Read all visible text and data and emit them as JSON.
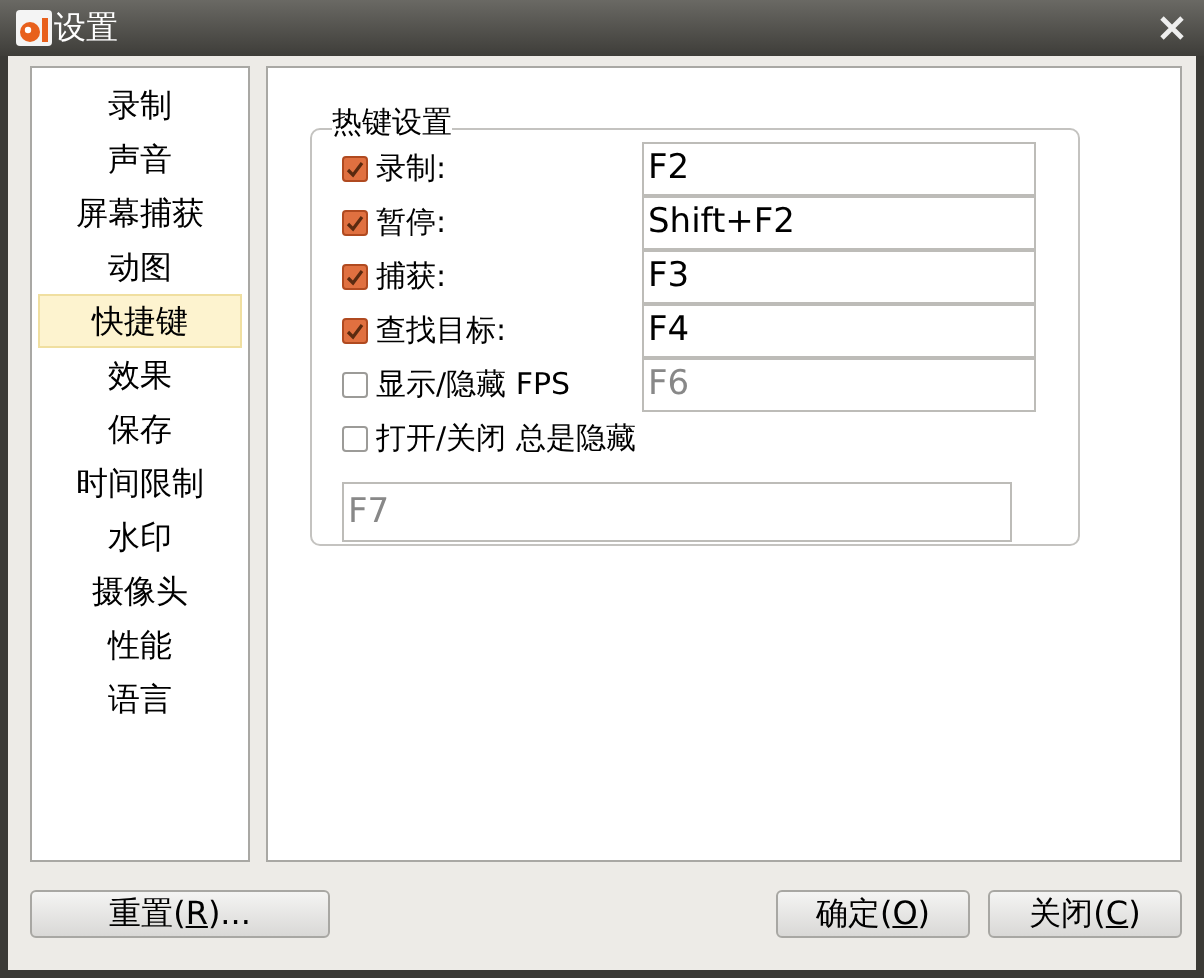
{
  "window": {
    "title": "设置"
  },
  "sidebar": {
    "items": [
      {
        "label": "录制",
        "selected": false
      },
      {
        "label": "声音",
        "selected": false
      },
      {
        "label": "屏幕捕获",
        "selected": false
      },
      {
        "label": "动图",
        "selected": false
      },
      {
        "label": "快捷键",
        "selected": true
      },
      {
        "label": "效果",
        "selected": false
      },
      {
        "label": "保存",
        "selected": false
      },
      {
        "label": "时间限制",
        "selected": false
      },
      {
        "label": "水印",
        "selected": false
      },
      {
        "label": "摄像头",
        "selected": false
      },
      {
        "label": "性能",
        "selected": false
      },
      {
        "label": "语言",
        "selected": false
      }
    ]
  },
  "hotkeys": {
    "title": "热键设置",
    "rows": [
      {
        "label": "录制:",
        "checked": true,
        "field": {
          "value": "F2",
          "disabled": false
        }
      },
      {
        "label": "暂停:",
        "checked": true,
        "field": {
          "value": "Shift+F2",
          "disabled": false
        }
      },
      {
        "label": "捕获:",
        "checked": true,
        "field": {
          "value": "F3",
          "disabled": false
        }
      },
      {
        "label": "查找目标:",
        "checked": true,
        "field": {
          "value": "F4",
          "disabled": false
        }
      },
      {
        "label": "显示/隐藏 FPS",
        "checked": false,
        "field": {
          "value": "F6",
          "disabled": true
        }
      },
      {
        "label": "打开/关闭 总是隐藏",
        "checked": false
      }
    ],
    "wide_field": {
      "value": "F7",
      "disabled": true
    }
  },
  "buttons": [
    {
      "before": "重置(",
      "key": "R",
      "after": ")..."
    },
    {
      "before": "确定(",
      "key": "O",
      "after": ")"
    },
    {
      "before": "关闭(",
      "key": "C",
      "after": ")"
    }
  ]
}
